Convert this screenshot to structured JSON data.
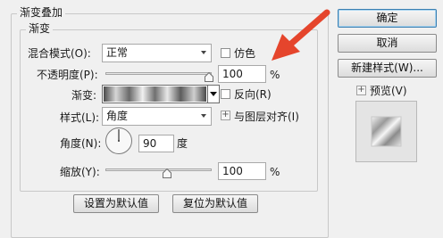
{
  "panel": {
    "title": "渐变叠加",
    "group_title": "渐变"
  },
  "blend_mode": {
    "label": "混合模式(O):",
    "value": "正常"
  },
  "dither": {
    "label": "仿色",
    "checked": false
  },
  "opacity": {
    "label": "不透明度(P):",
    "value": "100",
    "unit": "%",
    "level": 1.0
  },
  "gradient": {
    "label": "渐变:",
    "reverse_label": "反向(R)",
    "reverse_checked": false
  },
  "style": {
    "label": "样式(L):",
    "value": "角度",
    "align_label": "与图层对齐(I)",
    "align_checked": true
  },
  "angle": {
    "label": "角度(N):",
    "value": "90",
    "unit": "度",
    "degrees": 90
  },
  "scale": {
    "label": "缩放(Y):",
    "value": "100",
    "unit": "%",
    "level": 0.5
  },
  "bottom_buttons": {
    "make_default": "设置为默认值",
    "reset_default": "复位为默认值"
  },
  "side_buttons": {
    "ok": "确定",
    "cancel": "取消",
    "new_style": "新建样式(W)..."
  },
  "preview": {
    "label": "预览(V)",
    "checked": true
  },
  "colors": {
    "arrow": "#e5452c",
    "accent_border": "#3c7fb1"
  }
}
